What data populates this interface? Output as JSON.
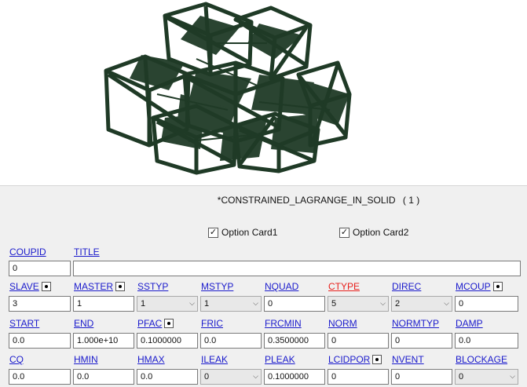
{
  "card": {
    "title": "*CONSTRAINED_LAGRANGE_IN_SOLID",
    "count": "( 1 )"
  },
  "options": [
    {
      "label": "Option Card1",
      "checked": true
    },
    {
      "label": "Option Card2",
      "checked": true
    }
  ],
  "row1": {
    "coupid": {
      "label": "COUPID",
      "value": "0"
    },
    "title": {
      "label": "TITLE",
      "value": ""
    }
  },
  "row2": {
    "slave": {
      "label": "SLAVE",
      "value": "3"
    },
    "master": {
      "label": "MASTER",
      "value": "1"
    },
    "sstyp": {
      "label": "SSTYP",
      "value": "1"
    },
    "mstyp": {
      "label": "MSTYP",
      "value": "1"
    },
    "nquad": {
      "label": "NQUAD",
      "value": "0"
    },
    "ctype": {
      "label": "CTYPE",
      "value": "5"
    },
    "direc": {
      "label": "DIREC",
      "value": "2"
    },
    "mcoup": {
      "label": "MCOUP",
      "value": "0"
    }
  },
  "row3": {
    "start": {
      "label": "START",
      "value": "0.0"
    },
    "end": {
      "label": "END",
      "value": "1.000e+10"
    },
    "pfac": {
      "label": "PFAC",
      "value": "0.1000000"
    },
    "fric": {
      "label": "FRIC",
      "value": "0.0"
    },
    "frcmin": {
      "label": "FRCMIN",
      "value": "0.3500000"
    },
    "norm": {
      "label": "NORM",
      "value": "0"
    },
    "normtyp": {
      "label": "NORMTYP",
      "value": "0"
    },
    "damp": {
      "label": "DAMP",
      "value": "0.0"
    }
  },
  "row4": {
    "cq": {
      "label": "CQ",
      "value": "0.0"
    },
    "hmin": {
      "label": "HMIN",
      "value": "0.0"
    },
    "hmax": {
      "label": "HMAX",
      "value": "0.0"
    },
    "ileak": {
      "label": "ILEAK",
      "value": "0"
    },
    "pleak": {
      "label": "PLEAK",
      "value": "0.1000000"
    },
    "lcidpor": {
      "label": "LCIDPOR",
      "value": "0"
    },
    "nvent": {
      "label": "NVENT",
      "value": "0"
    },
    "blockage": {
      "label": "BLOCKAGE",
      "value": "0"
    }
  },
  "colors": {
    "model": "#1f3a26",
    "link": "#1a1acc",
    "required": "#e8201c"
  }
}
